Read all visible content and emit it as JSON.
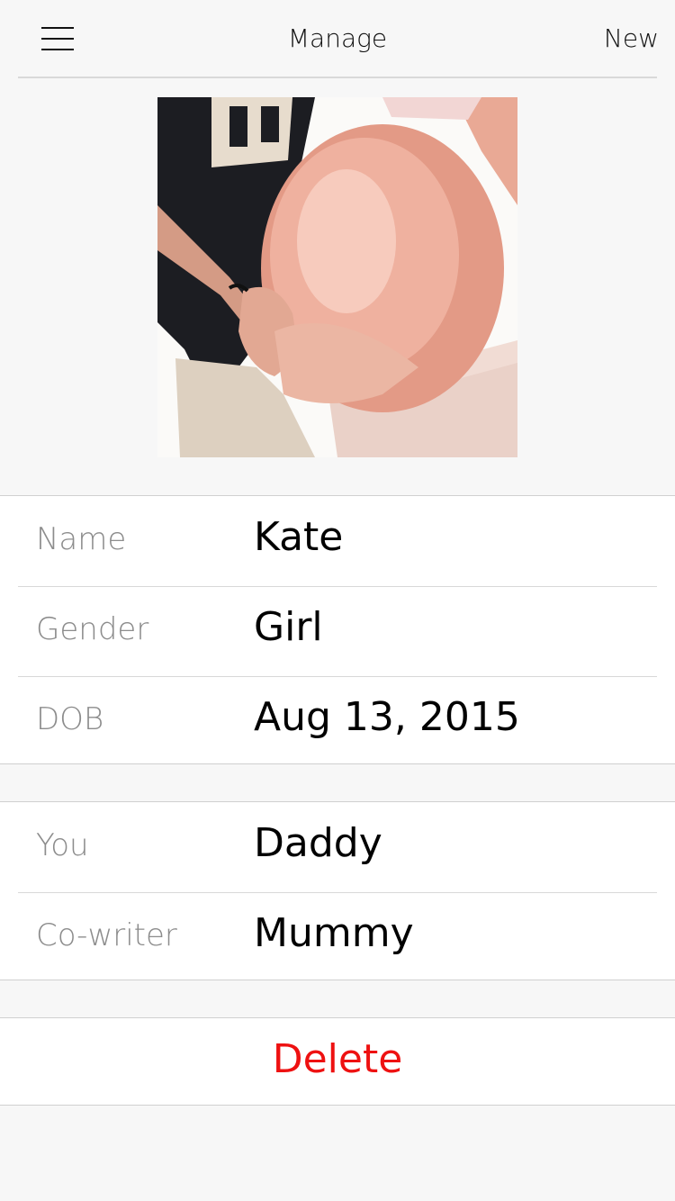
{
  "nav": {
    "title": "Manage",
    "right_action": "New",
    "menu_icon": "hamburger-menu-icon"
  },
  "profile": {
    "photo_subject": "pregnant-belly-photo"
  },
  "baby_info": [
    {
      "label": "Name",
      "value": "Kate"
    },
    {
      "label": "Gender",
      "value": "Girl"
    },
    {
      "label": "DOB",
      "value": "Aug 13, 2015"
    }
  ],
  "writers": [
    {
      "label": "You",
      "value": "Daddy"
    },
    {
      "label": "Co-writer",
      "value": "Mummy"
    }
  ],
  "delete_label": "Delete",
  "colors": {
    "background": "#f7f7f7",
    "label": "#8c8c8c",
    "delete": "#ee1111"
  }
}
